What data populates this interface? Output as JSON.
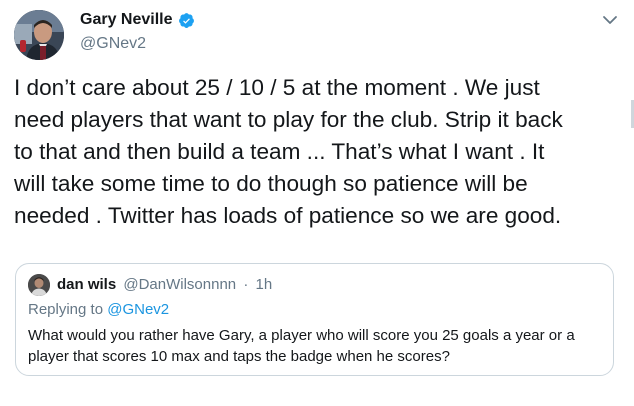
{
  "tweet": {
    "author": {
      "name": "Gary Neville",
      "handle": "@GNev2",
      "verified_color": "#1da1f2"
    },
    "text_lines": [
      "I don’t care about 25 / 10 / 5 at the moment . We just",
      "need players that want to play for the club. Strip it back",
      "to that and then build a team ... That’s what I want . It",
      "will take some time to do though so patience will be",
      "needed . Twitter has loads of patience so we are good."
    ],
    "menu_icon": "chevron-down-icon"
  },
  "quoted_tweet": {
    "author": {
      "name": "dan wils",
      "handle": "@DanWilsonnnn",
      "time": "1h"
    },
    "separator": "·",
    "replying_prefix": "Replying to",
    "replying_handle": "@GNev2",
    "text_lines": [
      "What would you rather have Gary, a player who will score you 25 goals a year or a",
      "player that scores 10 max and taps the badge when he scores?"
    ]
  },
  "colors": {
    "text": "#14171a",
    "secondary": "#657786",
    "link": "#1b95e0",
    "border": "#ccd6dd"
  }
}
